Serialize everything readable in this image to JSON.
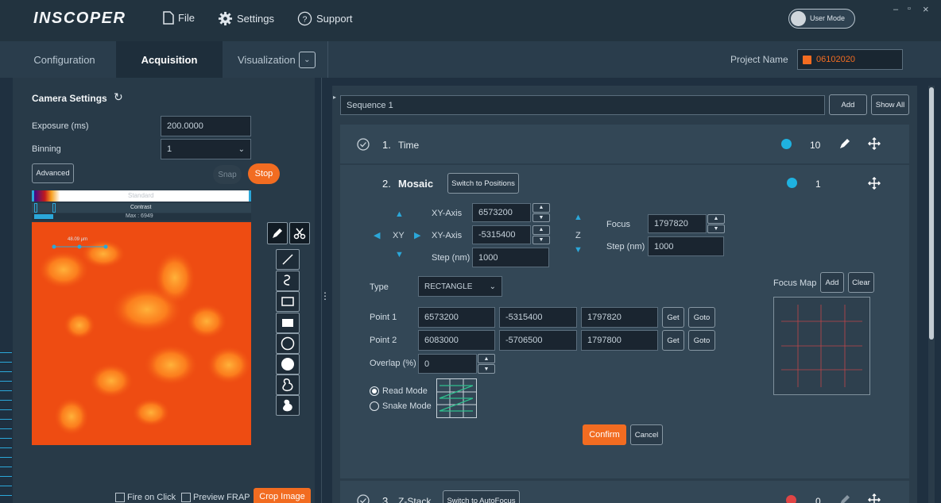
{
  "app": {
    "logo": "INSCOPER",
    "menu": {
      "file": "File",
      "settings": "Settings",
      "support": "Support"
    },
    "user_mode": "User Mode",
    "window_controls": {
      "minimize": "–",
      "maximize": "▫",
      "close": "×"
    }
  },
  "tabs": {
    "configuration": "Configuration",
    "acquisition": "Acquisition",
    "visualization": "Visualization",
    "project_name_label": "Project Name",
    "project_name_value": "06102020"
  },
  "camera": {
    "title": "Camera Settings",
    "exposure_label": "Exposure (ms)",
    "exposure_value": "200.0000",
    "binning_label": "Binning",
    "binning_value": "1",
    "advanced_label": "Advanced",
    "snap_label": "Snap",
    "stop_label": "Stop",
    "lut_label": "Standard",
    "contrast_label": "Contrast",
    "max_label": "Max : 6949",
    "scale_label": "48.09 µm",
    "fire_on_click": "Fire on Click",
    "preview_frap": "Preview FRAP",
    "crop_image": "Crop Image"
  },
  "sequence": {
    "name": "Sequence 1",
    "add_label": "Add",
    "show_all_label": "Show All",
    "steps": [
      {
        "number": "1.",
        "name": "Time",
        "count": "10",
        "dot_color": "#1fb2e0"
      },
      {
        "number": "2.",
        "name": "Mosaic",
        "count": "1",
        "dot_color": "#1fb2e0",
        "switch_label": "Switch to Positions"
      },
      {
        "number": "3.",
        "name": "Z-Stack",
        "count": "0",
        "dot_color": "#e04545",
        "switch_label": "Switch to AutoFocus"
      }
    ]
  },
  "mosaic": {
    "xy_axis_label": "XY-Axis",
    "x_value": "6573200",
    "y_value": "-5315400",
    "xy_step_label": "Step (nm)",
    "xy_step_value": "1000",
    "xy_label": "XY",
    "z_label": "Z",
    "focus_label": "Focus",
    "focus_value": "1797820",
    "z_step_label": "Step (nm)",
    "z_step_value": "1000",
    "type_label": "Type",
    "type_value": "RECTANGLE",
    "point1_label": "Point 1",
    "point1": [
      "6573200",
      "-5315400",
      "1797820"
    ],
    "point2_label": "Point 2",
    "point2": [
      "6083000",
      "-5706500",
      "1797800"
    ],
    "get_label": "Get",
    "goto_label": "Goto",
    "overlap_label": "Overlap (%)",
    "overlap_value": "0",
    "read_mode": "Read Mode",
    "snake_mode": "Snake Mode",
    "focus_map_label": "Focus Map",
    "focus_map_add": "Add",
    "focus_map_clear": "Clear",
    "confirm_label": "Confirm",
    "cancel_label": "Cancel"
  },
  "colors": {
    "accent": "#f26c21",
    "info": "#1fb2e0",
    "danger": "#e04545"
  }
}
